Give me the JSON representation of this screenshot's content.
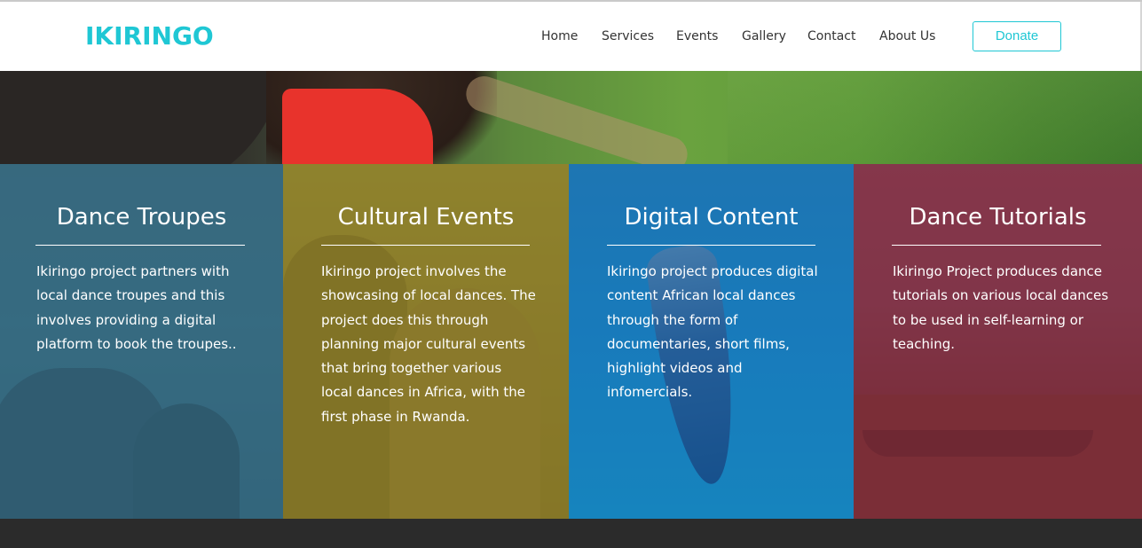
{
  "header": {
    "logo": "IKIRINGO",
    "nav": [
      "Home",
      "Services",
      "Events",
      "Gallery",
      "Contact",
      "About Us"
    ],
    "donate_label": "Donate"
  },
  "colors": {
    "accent": "#1fc7d4",
    "card1_overlay": "#346e87",
    "card2_overlay": "#9c8c28",
    "card3_overlay": "#146eb4",
    "card4_overlay": "#8c283c",
    "footer": "#2b2b2b"
  },
  "cards": [
    {
      "title": "Dance Troupes",
      "lines": [
        "Ikiringo project partners with",
        "local dance troupes and this",
        "involves providing a digital",
        "platform to book the troupes.."
      ]
    },
    {
      "title": "Cultural Events",
      "lines": [
        "Ikiringo project involves the",
        "showcasing of local dances. The",
        "project does this through",
        "planning major cultural events",
        "that bring together various",
        "local dances in Africa, with the",
        "first phase in Rwanda."
      ]
    },
    {
      "title": "Digital Content",
      "lines": [
        "Ikiringo project produces digital",
        "content African local dances",
        "through the form of",
        "documentaries, short films,",
        "highlight videos and",
        "infomercials."
      ]
    },
    {
      "title": "Dance Tutorials",
      "lines": [
        "Ikiringo Project produces dance",
        "tutorials on various local dances",
        "to be used in self-learning or",
        "teaching."
      ]
    }
  ]
}
